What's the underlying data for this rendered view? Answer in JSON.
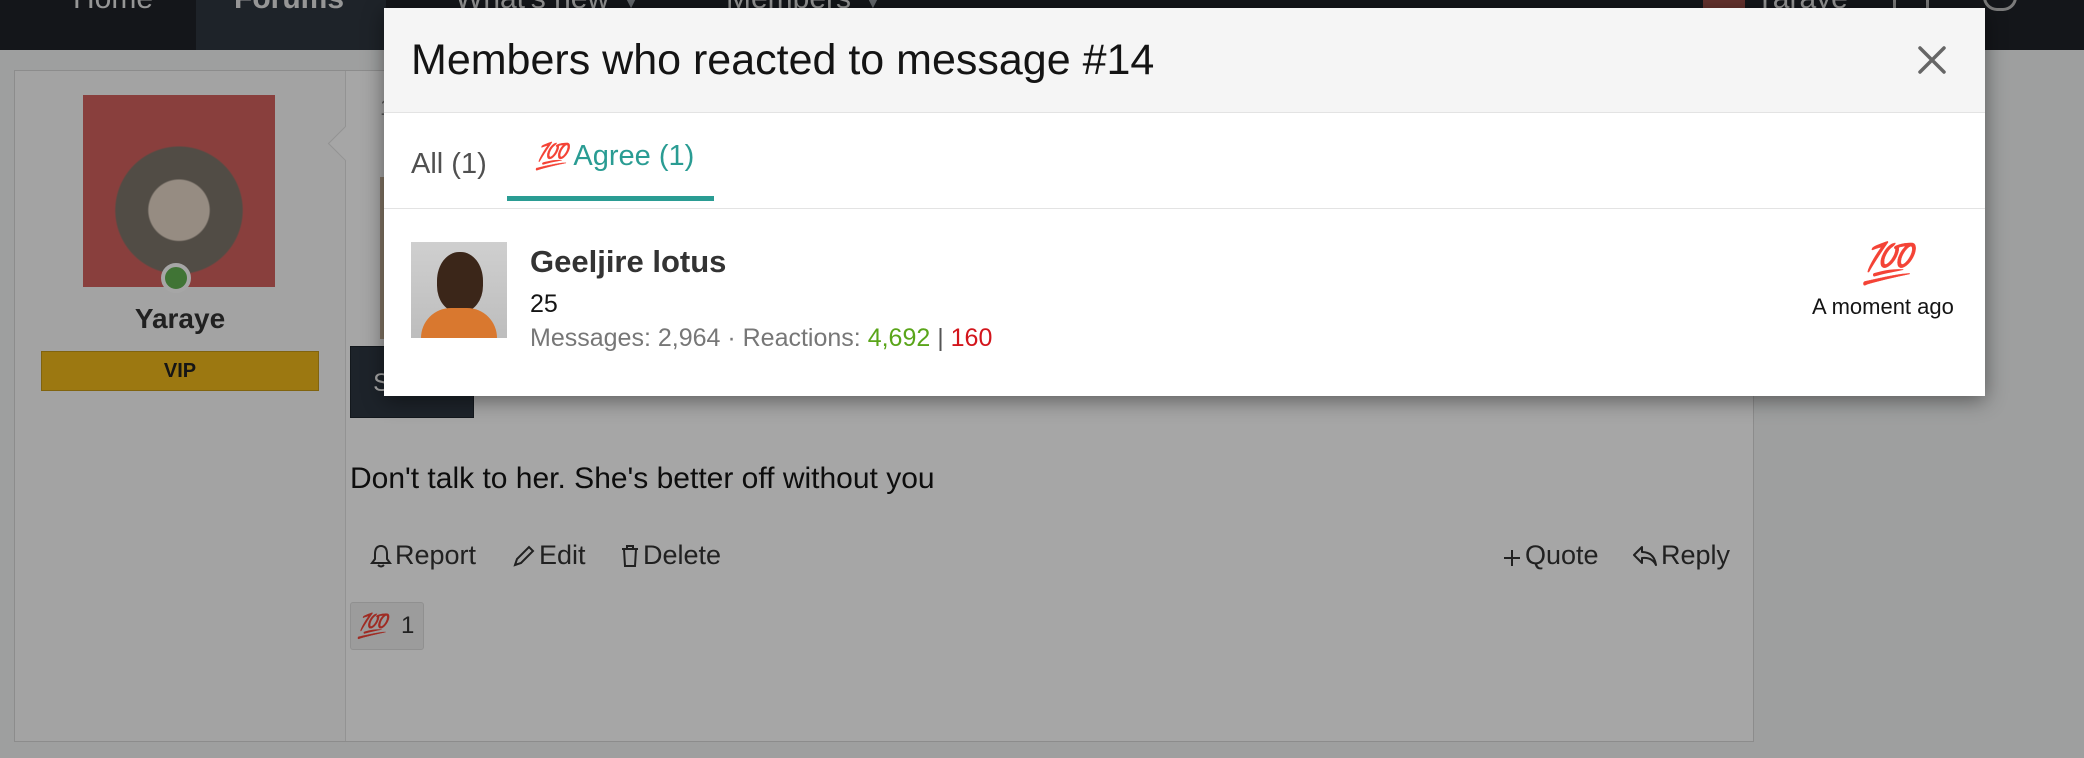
{
  "nav": {
    "items": [
      "Home",
      "Forums",
      "What's new",
      "Members"
    ],
    "user": "Yaraye"
  },
  "post": {
    "author": "Yaraye",
    "badge": "VIP",
    "meta_fragment": "1",
    "quote_fragment": "sc",
    "spoiler_label": "Spoiler",
    "text": "Don't talk to her. She's better off without you",
    "actions": {
      "report": "Report",
      "edit": "Edit",
      "delete": "Delete",
      "quote": "Quote",
      "reply": "Reply"
    },
    "reaction_emoji": "💯",
    "reaction_count": "1"
  },
  "modal": {
    "title": "Members who reacted to message #14",
    "tabs": [
      {
        "label": "All (1)",
        "active": false
      },
      {
        "emoji": "💯",
        "label": "Agree (1)",
        "active": true
      }
    ],
    "members": [
      {
        "name": "Geeljire lotus",
        "title": "25",
        "messages_label": "Messages: ",
        "messages": "2,964",
        "reactions_label": " · Reactions: ",
        "reactions_positive": "4,692",
        "reactions_separator": " | ",
        "reactions_negative": "160",
        "reaction_emoji": "💯",
        "time": "A moment ago"
      }
    ]
  },
  "colors": {
    "accent": "#2a9c93",
    "positive": "#5aa51a",
    "negative": "#d3151c",
    "vip": "#f0b81b",
    "nav_bg": "#1f2328"
  },
  "icons": [
    "close-icon",
    "bell-icon",
    "pencil-icon",
    "trash-icon",
    "plus-icon",
    "reply-icon"
  ]
}
